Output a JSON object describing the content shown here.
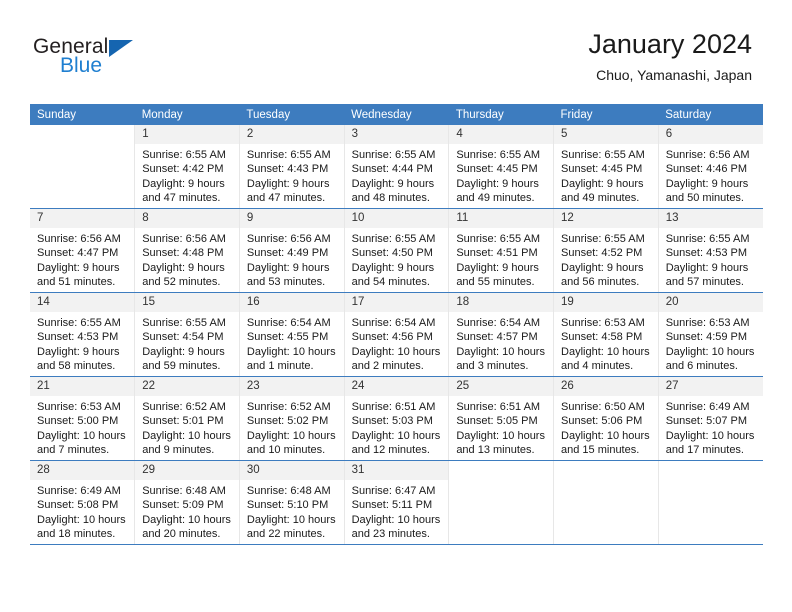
{
  "brand": {
    "name_top": "General",
    "name_bottom": "Blue",
    "triangle_color": "#1565b0",
    "blue_color": "#1f7fd0"
  },
  "header": {
    "title": "January 2024",
    "subtitle": "Chuo, Yamanashi, Japan"
  },
  "theme": {
    "header_row_bg": "#3d7cbf",
    "header_row_text": "#ffffff",
    "daynum_bg": "#f2f2f2",
    "grid_line": "#e7e7e7",
    "row_divider": "#3d7cbf"
  },
  "calendar": {
    "weekday_headers": [
      "Sunday",
      "Monday",
      "Tuesday",
      "Wednesday",
      "Thursday",
      "Friday",
      "Saturday"
    ],
    "weeks": [
      [
        {
          "day": "",
          "blank": true
        },
        {
          "day": "1",
          "sunrise": "Sunrise: 6:55 AM",
          "sunset": "Sunset: 4:42 PM",
          "daylight": "Daylight: 9 hours and 47 minutes."
        },
        {
          "day": "2",
          "sunrise": "Sunrise: 6:55 AM",
          "sunset": "Sunset: 4:43 PM",
          "daylight": "Daylight: 9 hours and 47 minutes."
        },
        {
          "day": "3",
          "sunrise": "Sunrise: 6:55 AM",
          "sunset": "Sunset: 4:44 PM",
          "daylight": "Daylight: 9 hours and 48 minutes."
        },
        {
          "day": "4",
          "sunrise": "Sunrise: 6:55 AM",
          "sunset": "Sunset: 4:45 PM",
          "daylight": "Daylight: 9 hours and 49 minutes."
        },
        {
          "day": "5",
          "sunrise": "Sunrise: 6:55 AM",
          "sunset": "Sunset: 4:45 PM",
          "daylight": "Daylight: 9 hours and 49 minutes."
        },
        {
          "day": "6",
          "sunrise": "Sunrise: 6:56 AM",
          "sunset": "Sunset: 4:46 PM",
          "daylight": "Daylight: 9 hours and 50 minutes."
        }
      ],
      [
        {
          "day": "7",
          "sunrise": "Sunrise: 6:56 AM",
          "sunset": "Sunset: 4:47 PM",
          "daylight": "Daylight: 9 hours and 51 minutes."
        },
        {
          "day": "8",
          "sunrise": "Sunrise: 6:56 AM",
          "sunset": "Sunset: 4:48 PM",
          "daylight": "Daylight: 9 hours and 52 minutes."
        },
        {
          "day": "9",
          "sunrise": "Sunrise: 6:56 AM",
          "sunset": "Sunset: 4:49 PM",
          "daylight": "Daylight: 9 hours and 53 minutes."
        },
        {
          "day": "10",
          "sunrise": "Sunrise: 6:55 AM",
          "sunset": "Sunset: 4:50 PM",
          "daylight": "Daylight: 9 hours and 54 minutes."
        },
        {
          "day": "11",
          "sunrise": "Sunrise: 6:55 AM",
          "sunset": "Sunset: 4:51 PM",
          "daylight": "Daylight: 9 hours and 55 minutes."
        },
        {
          "day": "12",
          "sunrise": "Sunrise: 6:55 AM",
          "sunset": "Sunset: 4:52 PM",
          "daylight": "Daylight: 9 hours and 56 minutes."
        },
        {
          "day": "13",
          "sunrise": "Sunrise: 6:55 AM",
          "sunset": "Sunset: 4:53 PM",
          "daylight": "Daylight: 9 hours and 57 minutes."
        }
      ],
      [
        {
          "day": "14",
          "sunrise": "Sunrise: 6:55 AM",
          "sunset": "Sunset: 4:53 PM",
          "daylight": "Daylight: 9 hours and 58 minutes."
        },
        {
          "day": "15",
          "sunrise": "Sunrise: 6:55 AM",
          "sunset": "Sunset: 4:54 PM",
          "daylight": "Daylight: 9 hours and 59 minutes."
        },
        {
          "day": "16",
          "sunrise": "Sunrise: 6:54 AM",
          "sunset": "Sunset: 4:55 PM",
          "daylight": "Daylight: 10 hours and 1 minute."
        },
        {
          "day": "17",
          "sunrise": "Sunrise: 6:54 AM",
          "sunset": "Sunset: 4:56 PM",
          "daylight": "Daylight: 10 hours and 2 minutes."
        },
        {
          "day": "18",
          "sunrise": "Sunrise: 6:54 AM",
          "sunset": "Sunset: 4:57 PM",
          "daylight": "Daylight: 10 hours and 3 minutes."
        },
        {
          "day": "19",
          "sunrise": "Sunrise: 6:53 AM",
          "sunset": "Sunset: 4:58 PM",
          "daylight": "Daylight: 10 hours and 4 minutes."
        },
        {
          "day": "20",
          "sunrise": "Sunrise: 6:53 AM",
          "sunset": "Sunset: 4:59 PM",
          "daylight": "Daylight: 10 hours and 6 minutes."
        }
      ],
      [
        {
          "day": "21",
          "sunrise": "Sunrise: 6:53 AM",
          "sunset": "Sunset: 5:00 PM",
          "daylight": "Daylight: 10 hours and 7 minutes."
        },
        {
          "day": "22",
          "sunrise": "Sunrise: 6:52 AM",
          "sunset": "Sunset: 5:01 PM",
          "daylight": "Daylight: 10 hours and 9 minutes."
        },
        {
          "day": "23",
          "sunrise": "Sunrise: 6:52 AM",
          "sunset": "Sunset: 5:02 PM",
          "daylight": "Daylight: 10 hours and 10 minutes."
        },
        {
          "day": "24",
          "sunrise": "Sunrise: 6:51 AM",
          "sunset": "Sunset: 5:03 PM",
          "daylight": "Daylight: 10 hours and 12 minutes."
        },
        {
          "day": "25",
          "sunrise": "Sunrise: 6:51 AM",
          "sunset": "Sunset: 5:05 PM",
          "daylight": "Daylight: 10 hours and 13 minutes."
        },
        {
          "day": "26",
          "sunrise": "Sunrise: 6:50 AM",
          "sunset": "Sunset: 5:06 PM",
          "daylight": "Daylight: 10 hours and 15 minutes."
        },
        {
          "day": "27",
          "sunrise": "Sunrise: 6:49 AM",
          "sunset": "Sunset: 5:07 PM",
          "daylight": "Daylight: 10 hours and 17 minutes."
        }
      ],
      [
        {
          "day": "28",
          "sunrise": "Sunrise: 6:49 AM",
          "sunset": "Sunset: 5:08 PM",
          "daylight": "Daylight: 10 hours and 18 minutes."
        },
        {
          "day": "29",
          "sunrise": "Sunrise: 6:48 AM",
          "sunset": "Sunset: 5:09 PM",
          "daylight": "Daylight: 10 hours and 20 minutes."
        },
        {
          "day": "30",
          "sunrise": "Sunrise: 6:48 AM",
          "sunset": "Sunset: 5:10 PM",
          "daylight": "Daylight: 10 hours and 22 minutes."
        },
        {
          "day": "31",
          "sunrise": "Sunrise: 6:47 AM",
          "sunset": "Sunset: 5:11 PM",
          "daylight": "Daylight: 10 hours and 23 minutes."
        },
        {
          "day": "",
          "blank": true
        },
        {
          "day": "",
          "blank": true
        },
        {
          "day": "",
          "blank": true
        }
      ]
    ]
  }
}
